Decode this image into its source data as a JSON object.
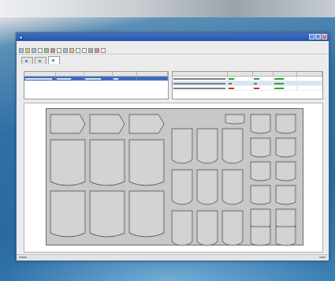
{
  "colors": {
    "title_bar": "#2356ad",
    "selection": "#3c6bbd",
    "plate": "#c8c8c8",
    "part_fill": "#d3d3d3",
    "value_green": "#35a035",
    "value_red": "#d02a2a"
  },
  "window": {
    "title": "",
    "controls": [
      "minimize-icon",
      "maximize-icon",
      "close-icon"
    ]
  },
  "menu": [],
  "toolbar": {
    "button_count": 14
  },
  "tabs": [
    {
      "label": "",
      "icon": "tab-icon",
      "active": false
    },
    {
      "label": "",
      "icon": "tab-icon",
      "active": false
    },
    {
      "label": "",
      "icon": "tab-icon",
      "active": true
    }
  ],
  "left_grid": {
    "column_count": 5,
    "row_count": 1,
    "selected_row": 0
  },
  "right_grid": {
    "column_count": 5,
    "row_count": 3,
    "selected_row": 1
  },
  "plate": {
    "parts": [
      {
        "shape": "tag"
      },
      {
        "shape": "tag"
      },
      {
        "shape": "tag"
      },
      {
        "shape": "tall-panel"
      },
      {
        "shape": "tall-panel"
      },
      {
        "shape": "tall-panel"
      },
      {
        "shape": "tall-panel"
      },
      {
        "shape": "tall-panel"
      },
      {
        "shape": "tall-panel"
      },
      {
        "shape": "small-panel"
      },
      {
        "shape": "small-panel"
      },
      {
        "shape": "small-panel"
      },
      {
        "shape": "small-panel"
      },
      {
        "shape": "small-panel"
      },
      {
        "shape": "small-panel"
      },
      {
        "shape": "small-panel"
      },
      {
        "shape": "small-panel"
      },
      {
        "shape": "small-panel"
      },
      {
        "shape": "small-panel"
      },
      {
        "shape": "small-panel"
      },
      {
        "shape": "small-panel"
      },
      {
        "shape": "small-panel"
      },
      {
        "shape": "small-panel"
      },
      {
        "shape": "small-panel"
      },
      {
        "shape": "small-panel"
      },
      {
        "shape": "small-panel"
      },
      {
        "shape": "small-panel"
      },
      {
        "shape": "small-panel"
      },
      {
        "shape": "small-panel"
      },
      {
        "shape": "small-panel"
      },
      {
        "shape": "small-panel"
      },
      {
        "shape": "small-panel"
      },
      {
        "shape": "small-panel"
      },
      {
        "shape": "small-panel"
      }
    ]
  },
  "status": {
    "left": "",
    "right": ""
  }
}
